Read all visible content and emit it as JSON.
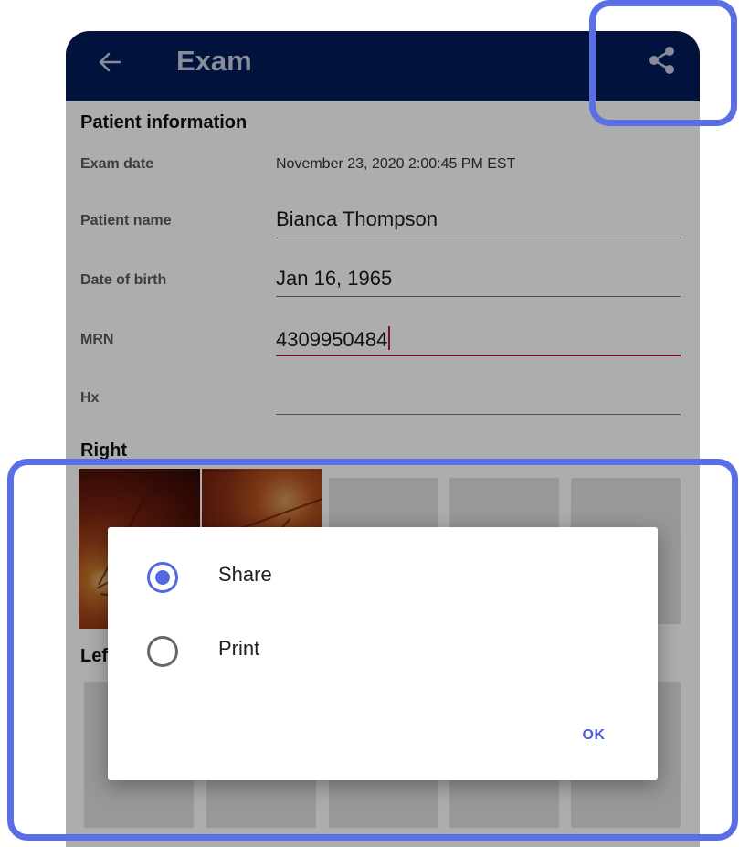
{
  "appbar": {
    "title": "Exam",
    "back_icon": "arrow-left-icon",
    "share_icon": "share-icon",
    "background": "#021c5b"
  },
  "patient": {
    "section_title": "Patient information",
    "fields": [
      {
        "label": "Exam date",
        "value": "November 23, 2020 2:00:45 PM EST"
      },
      {
        "label": "Patient name",
        "value": "Bianca Thompson"
      },
      {
        "label": "Date of birth",
        "value": "Jan 16, 1965"
      },
      {
        "label": "MRN",
        "value": "4309950484"
      },
      {
        "label": "Hx",
        "value": ""
      }
    ]
  },
  "right_section": {
    "title": "Right"
  },
  "left_section": {
    "title": "Left"
  },
  "dialog": {
    "options": [
      {
        "label": "Share",
        "selected": true
      },
      {
        "label": "Print",
        "selected": false
      }
    ],
    "ok_label": "OK"
  },
  "colors": {
    "accent": "#5468e2",
    "highlight": "#5a6ee6",
    "active_field": "#b0154a"
  }
}
